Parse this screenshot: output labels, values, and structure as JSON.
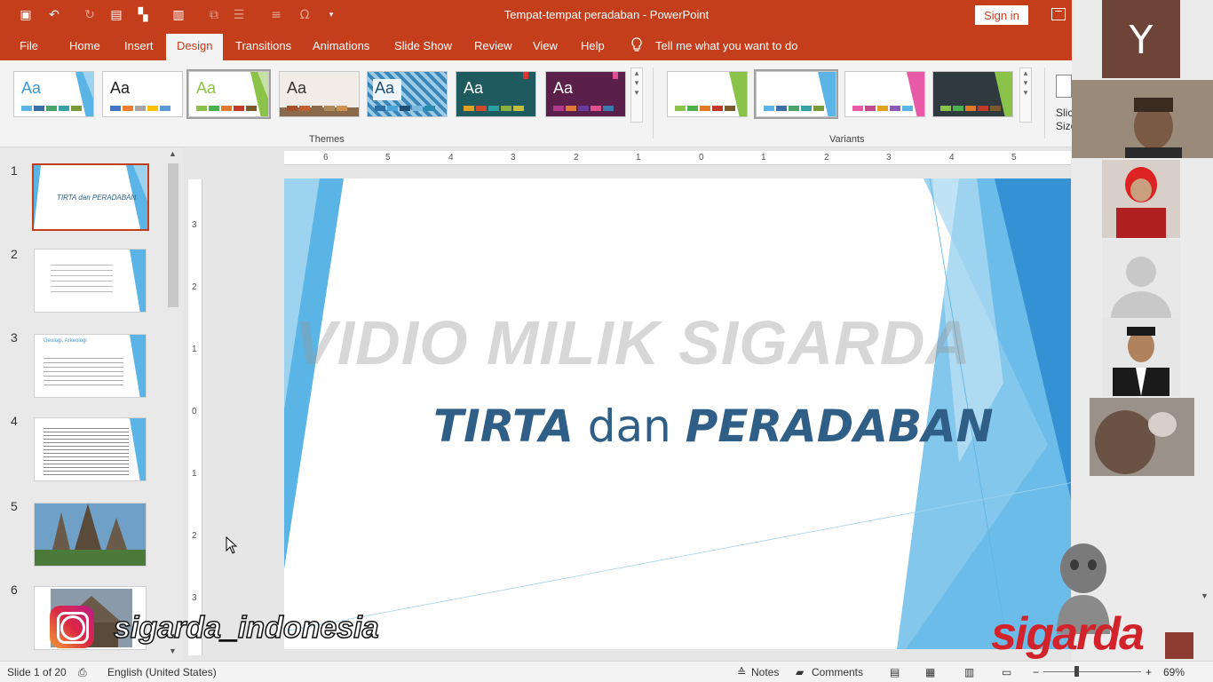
{
  "window": {
    "title": "Tempat-tempat peradaban  -  PowerPoint",
    "signin_label": "Sign in"
  },
  "tabs": [
    "File",
    "Home",
    "Insert",
    "Design",
    "Transitions",
    "Animations",
    "Slide Show",
    "Review",
    "View",
    "Help"
  ],
  "active_tab": "Design",
  "tell_me": "Tell me what you want to do",
  "ribbon": {
    "themes_label": "Themes",
    "variants_label": "Variants",
    "theme_aa": "Aa",
    "slide_size_label_1": "Slic",
    "slide_size_label_2": "Size"
  },
  "slides": [
    {
      "num": "1",
      "text": "TIRTA dan PERADABAN"
    },
    {
      "num": "2",
      "text": ""
    },
    {
      "num": "3",
      "text": "Geologi, Arkeologi"
    },
    {
      "num": "4",
      "text": ""
    },
    {
      "num": "5",
      "text": ""
    },
    {
      "num": "6",
      "text": ""
    }
  ],
  "ruler_h": [
    "6",
    "5",
    "4",
    "3",
    "2",
    "1",
    "0",
    "1",
    "2",
    "3",
    "4",
    "5"
  ],
  "ruler_v": [
    "3",
    "2",
    "1",
    "0",
    "1",
    "2",
    "3"
  ],
  "slide": {
    "watermark": "VIDIO MILIK SIGARDA",
    "title_a": "TIRTA",
    "title_b": " dan ",
    "title_c": "PERADABAN"
  },
  "video": {
    "initial": "Y"
  },
  "status": {
    "slide_of": "Slide 1 of 20",
    "language": "English (United States)",
    "notes": "Notes",
    "comments": "Comments",
    "zoom": "69%"
  },
  "overlay": {
    "instagram": "sigarda_indonesia",
    "brand": "sigarda"
  },
  "colors": {
    "accent": "#c43e1c",
    "slide_blue": "#2f5f86",
    "theme_blue": "#5ab4e5"
  }
}
